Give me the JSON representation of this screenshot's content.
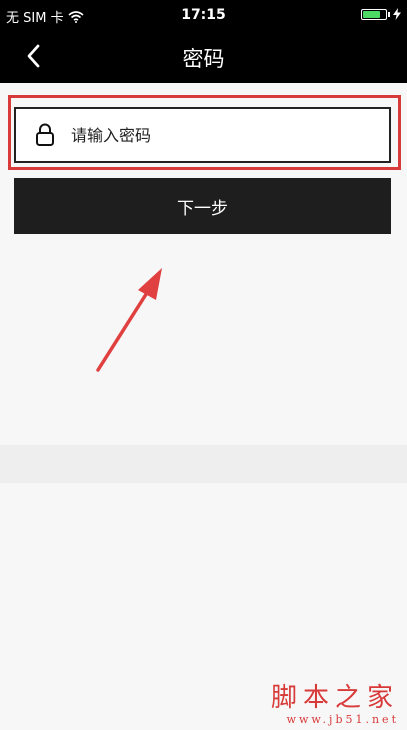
{
  "status_bar": {
    "carrier": "无 SIM 卡",
    "time": "17:15",
    "battery_level": 0.85,
    "battery_color": "#4cd964"
  },
  "nav": {
    "title": "密码",
    "back_icon": "chevron-left-icon"
  },
  "password_field": {
    "placeholder": "请输入密码",
    "value": "",
    "icon": "lock-icon"
  },
  "next_button": {
    "label": "下一步"
  },
  "annotation": {
    "highlight_color": "#d83a3a",
    "arrow_color": "#e04040"
  },
  "watermark": {
    "main": "脚本之家",
    "sub": "www.jb51.net"
  }
}
